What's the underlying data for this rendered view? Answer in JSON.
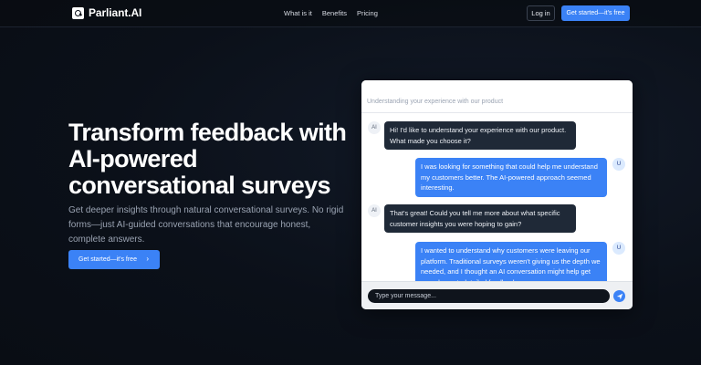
{
  "nav": {
    "brand": "Parliant.AI",
    "links": [
      {
        "label": "What is it"
      },
      {
        "label": "Benefits"
      },
      {
        "label": "Pricing"
      }
    ],
    "login_label": "Log in",
    "cta_label": "Get started—it's free"
  },
  "hero": {
    "title": "Transform feedback with AI-powered conversational surveys",
    "subtitle": "Get deeper insights through natural conversational surveys. No rigid forms—just AI-guided conversations that encourage honest, complete answers.",
    "cta_label": "Get started—it's free",
    "cta_icon": "chevron-right-icon"
  },
  "chat": {
    "header": "Understanding your experience with our product",
    "messages": [
      {
        "sender": "AI",
        "avatar": "AI",
        "text": "Hi! I'd like to understand your experience with our product. What made you choose it?"
      },
      {
        "sender": "U",
        "avatar": "U",
        "text": "I was looking for something that could help me understand my customers better. The AI-powered approach seemed interesting."
      },
      {
        "sender": "AI",
        "avatar": "AI",
        "text": "That's great! Could you tell me more about what specific customer insights you were hoping to gain?"
      },
      {
        "sender": "U",
        "avatar": "U",
        "text": "I wanted to understand why customers were leaving our platform. Traditional surveys weren't giving us the depth we needed, and I thought an AI conversation might help get more honest, detailed feedback."
      }
    ],
    "input_placeholder": "Type your message...",
    "send_icon": "send-icon"
  },
  "colors": {
    "accent": "#3b82f6",
    "background": "#0b1019",
    "ai_bubble": "#1f2937",
    "user_bubble": "#3b82f6"
  }
}
